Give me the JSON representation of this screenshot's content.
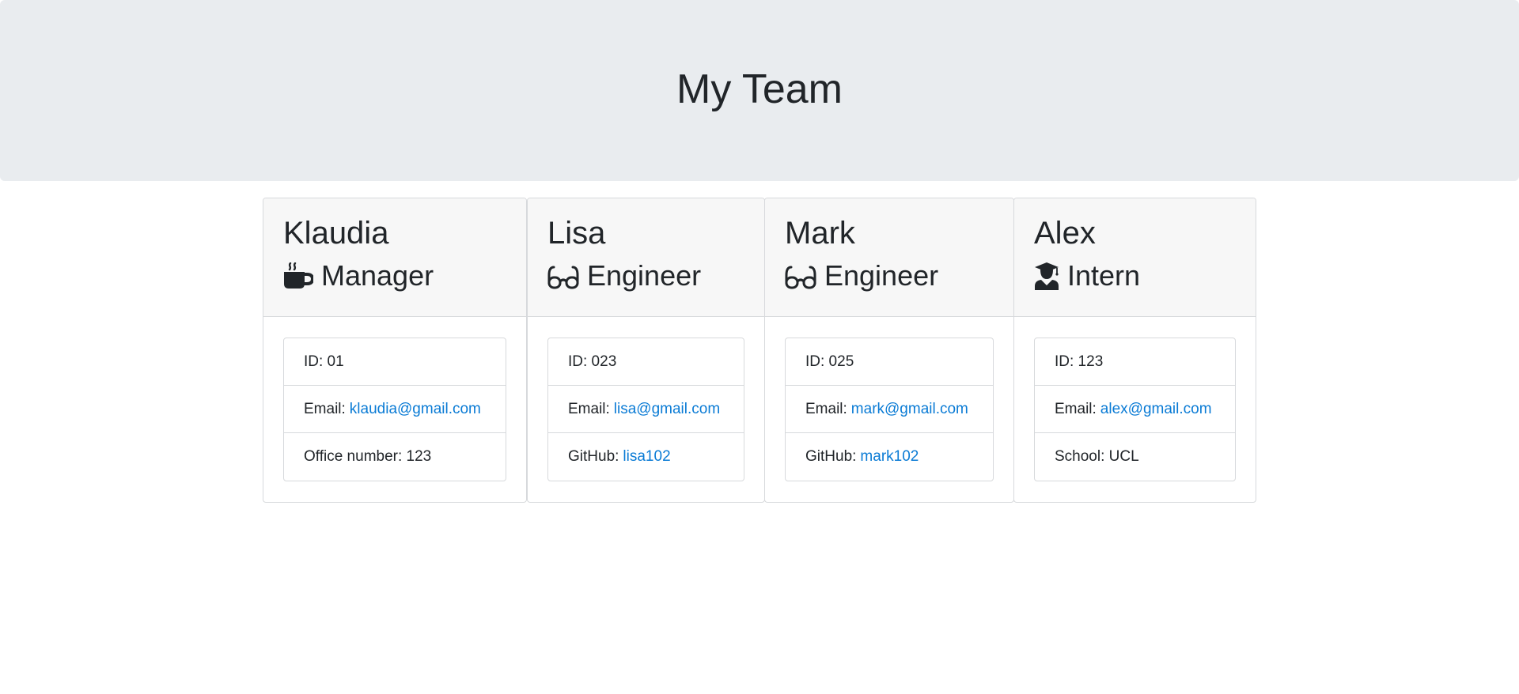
{
  "header": {
    "title": "My Team"
  },
  "team": [
    {
      "name": "Klaudia",
      "role": "Manager",
      "role_icon": "coffee-mug-icon",
      "id_label": "ID: 01",
      "email_prefix": "Email:",
      "email": "klaudia@gmail.com",
      "extra_prefix": "Office number: 123",
      "extra_link": ""
    },
    {
      "name": "Lisa",
      "role": "Engineer",
      "role_icon": "glasses-icon",
      "id_label": "ID: 023",
      "email_prefix": "Email:",
      "email": "lisa@gmail.com",
      "extra_prefix": "GitHub:",
      "extra_link": "lisa102"
    },
    {
      "name": "Mark",
      "role": "Engineer",
      "role_icon": "glasses-icon",
      "id_label": "ID: 025",
      "email_prefix": "Email:",
      "email": "mark@gmail.com",
      "extra_prefix": "GitHub:",
      "extra_link": "mark102"
    },
    {
      "name": "Alex",
      "role": "Intern",
      "role_icon": "graduate-icon",
      "id_label": "ID: 123",
      "email_prefix": "Email:",
      "email": "alex@gmail.com",
      "extra_prefix": "School: UCL",
      "extra_link": ""
    }
  ],
  "colors": {
    "header_bg": "#e9ecef",
    "card_header_bg": "#f7f7f7",
    "link": "#0a7bd5",
    "text": "#212529",
    "border": "#d7d9dc"
  }
}
